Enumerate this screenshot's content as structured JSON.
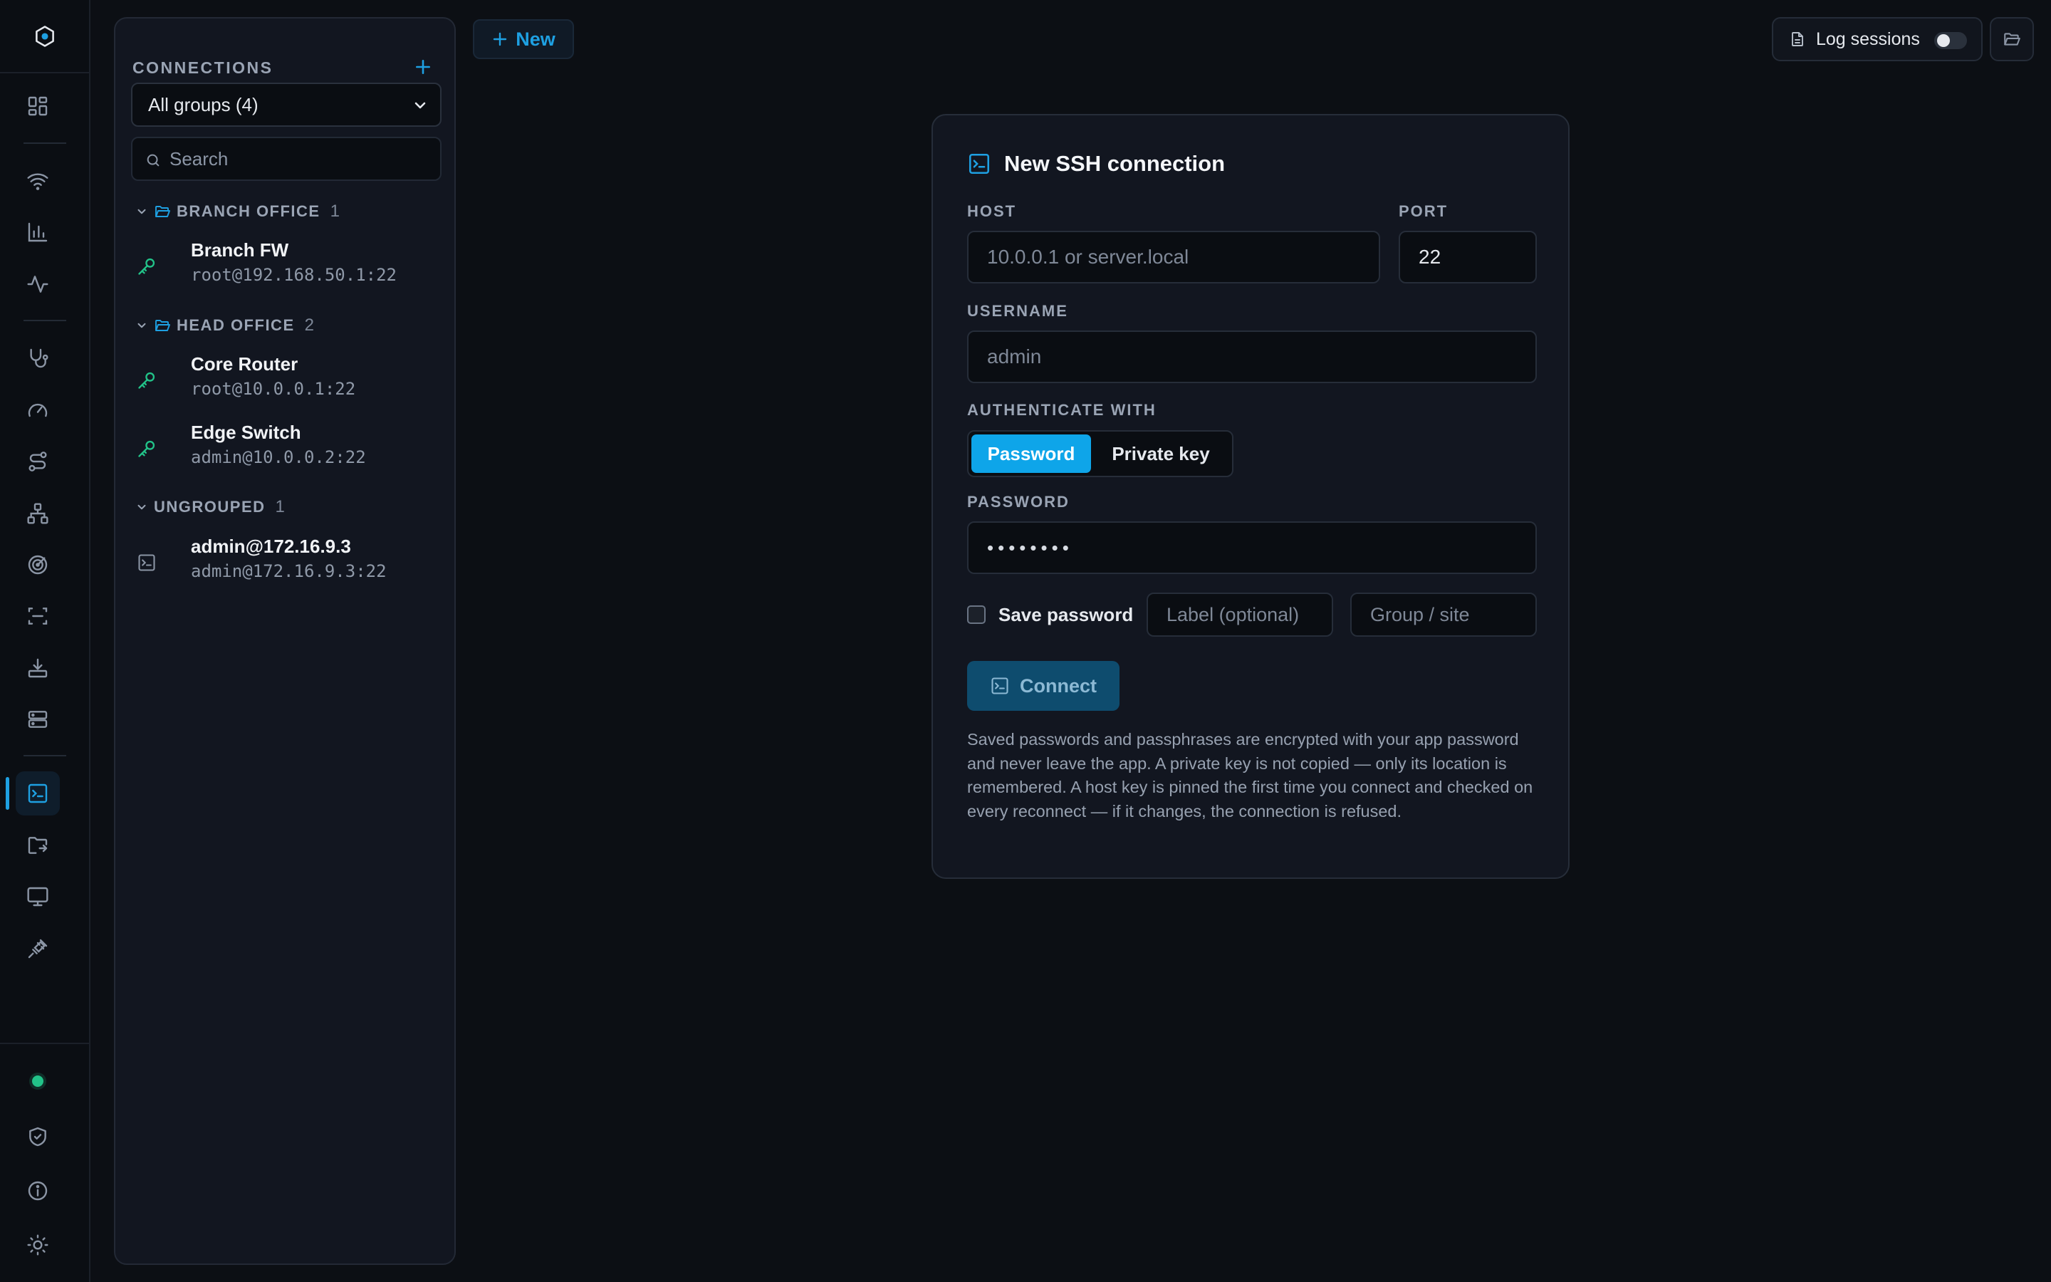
{
  "colors": {
    "accent": "#1ea0e2",
    "segment_active": "#0ea5e9",
    "status_ok": "#22c389",
    "key_icon": "#22c389",
    "background": "#0c0f14"
  },
  "rail": {
    "logo_icon": "hexagon-logo-icon",
    "items": [
      {
        "icon": "dashboard-grid-icon"
      },
      {
        "icon": "wifi-icon"
      },
      {
        "icon": "bar-chart-icon"
      },
      {
        "icon": "activity-pulse-icon"
      },
      {
        "icon": "stethoscope-icon"
      },
      {
        "icon": "speed-gauge-icon"
      },
      {
        "icon": "route-icon"
      },
      {
        "icon": "network-topology-icon"
      },
      {
        "icon": "radar-icon"
      },
      {
        "icon": "scan-icon"
      },
      {
        "icon": "download-tray-icon"
      },
      {
        "icon": "server-icon"
      },
      {
        "icon": "terminal-icon",
        "active": true
      },
      {
        "icon": "folder-sync-icon"
      },
      {
        "icon": "monitor-icon"
      },
      {
        "icon": "plug-icon"
      }
    ],
    "bottom": [
      {
        "icon": "status-dot-icon"
      },
      {
        "icon": "shield-check-icon"
      },
      {
        "icon": "info-icon"
      },
      {
        "icon": "sun-icon"
      }
    ]
  },
  "sidebar": {
    "title": "CONNECTIONS",
    "group_filter": "All groups (4)",
    "search_placeholder": "Search",
    "groups": [
      {
        "name": "BRANCH OFFICE",
        "count": "1",
        "connections": [
          {
            "name": "Branch FW",
            "address": "root@192.168.50.1:22",
            "icon": "key-icon"
          }
        ]
      },
      {
        "name": "HEAD OFFICE",
        "count": "2",
        "connections": [
          {
            "name": "Core Router",
            "address": "root@10.0.0.1:22",
            "icon": "key-icon"
          },
          {
            "name": "Edge Switch",
            "address": "admin@10.0.0.2:22",
            "icon": "key-icon"
          }
        ]
      },
      {
        "name": "UNGROUPED",
        "count": "1",
        "connections": [
          {
            "name": "admin@172.16.9.3",
            "address": "admin@172.16.9.3:22",
            "icon": "terminal-icon"
          }
        ]
      }
    ]
  },
  "toolbar": {
    "new_label": "New",
    "log_sessions_label": "Log sessions",
    "log_sessions_on": false
  },
  "form": {
    "title": "New SSH connection",
    "host_label": "HOST",
    "host_placeholder": "10.0.0.1 or server.local",
    "port_label": "PORT",
    "port_value": "22",
    "username_label": "USERNAME",
    "username_placeholder": "admin",
    "auth_label": "AUTHENTICATE WITH",
    "auth_options": [
      "Password",
      "Private key"
    ],
    "auth_selected": "Password",
    "password_label": "PASSWORD",
    "password_value": "••••••••",
    "save_password_label": "Save password",
    "save_password_checked": false,
    "label_placeholder": "Label (optional)",
    "group_placeholder": "Group / site",
    "connect_label": "Connect",
    "note": "Saved passwords and passphrases are encrypted with your app password and never leave the app. A private key is not copied — only its location is remembered. A host key is pinned the first time you connect and checked on every reconnect — if it changes, the connection is refused."
  }
}
